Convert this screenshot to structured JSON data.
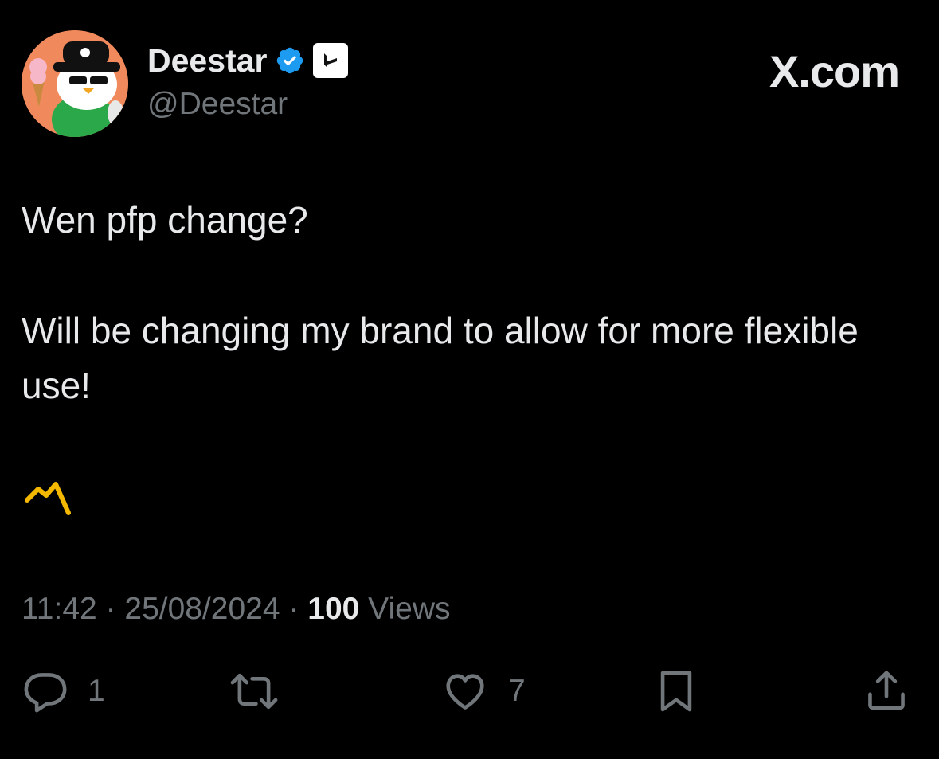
{
  "author": {
    "display_name": "Deestar",
    "handle": "@Deestar",
    "avatar_icon": "penguin-avatar-icon",
    "verified_icon": "verified-badge-icon",
    "affiliate_icon": "affiliate-badge-icon"
  },
  "brand": {
    "label": "X.com"
  },
  "tweet": {
    "paragraphs": [
      "Wen pfp change?",
      "Will be changing my brand to allow for more flexible use!"
    ],
    "emoji_icon": "lightning-zigzag-emoji"
  },
  "meta": {
    "time": "11:42",
    "sep1": " · ",
    "date": "25/08/2024",
    "sep2": " · ",
    "views_count": "100",
    "views_label": " Views"
  },
  "actions": {
    "reply_count": "1",
    "like_count": "7"
  },
  "colors": {
    "background": "#000000",
    "text": "#e7e9ea",
    "secondary": "#71767b",
    "verified": "#1d9bf0",
    "emoji": "#f5b800"
  }
}
